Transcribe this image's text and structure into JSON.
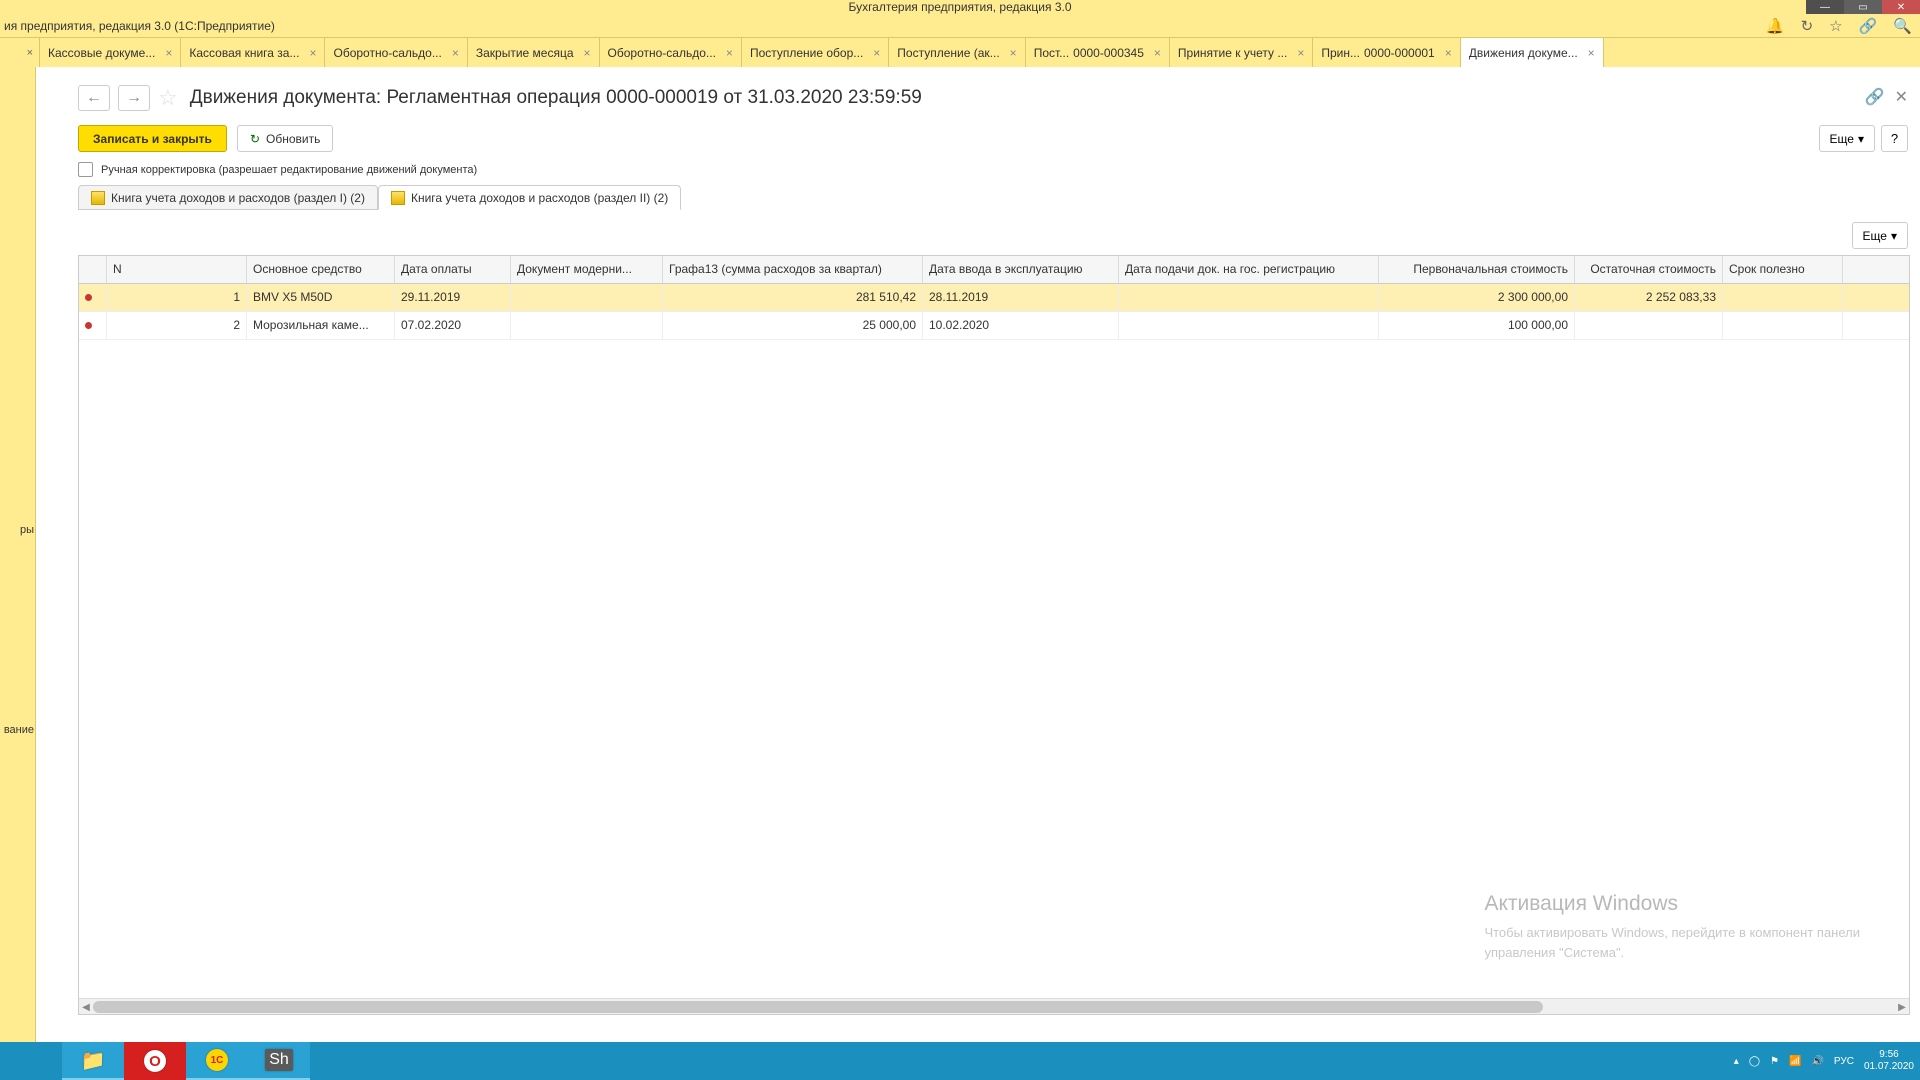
{
  "app": {
    "title": "Бухгалтерия предприятия, редакция 3.0",
    "subtitle": "ия предприятия, редакция 3.0   (1С:Предприятие)"
  },
  "tabs": {
    "items": [
      {
        "label": "Кассовые докуме..."
      },
      {
        "label": "Кассовая книга за..."
      },
      {
        "label": "Оборотно-сальдо..."
      },
      {
        "label": "Закрытие месяца"
      },
      {
        "label": "Оборотно-сальдо..."
      },
      {
        "label": "Поступление обор..."
      },
      {
        "label": "Поступление (ак..."
      },
      {
        "label": "Пост...",
        "label2": "0000-000345"
      },
      {
        "label": "Принятие к учету ..."
      },
      {
        "label": "Прин...",
        "label2": "0000-000001"
      },
      {
        "label": "Движения докуме...",
        "active": true
      }
    ]
  },
  "gutter": {
    "t1": "ры",
    "t2": "вание"
  },
  "page": {
    "title": "Движения документа: Регламентная операция 0000-000019 от 31.03.2020 23:59:59",
    "save": "Записать и закрыть",
    "refresh": "Обновить",
    "manual": "Ручная корректировка (разрешает редактирование движений документа)",
    "more": "Еще",
    "help": "?",
    "link_icon": "🔗",
    "close_icon": "✕"
  },
  "subtabs": {
    "t1": "Книга учета доходов и расходов (раздел I) (2)",
    "t2": "Книга учета доходов и расходов (раздел II) (2)"
  },
  "grid": {
    "headers": [
      "N",
      "Основное средство",
      "Дата оплаты",
      "Документ модерни...",
      "Графа13  (сумма расходов за квартал)",
      "Дата ввода в эксплуатацию",
      "Дата подачи док. на гос. регистрацию",
      "Первоначальная стоимость",
      "Остаточная стоимость",
      "Срок полезно"
    ],
    "rows": [
      {
        "n": "1",
        "asset": "BMV X5 M50D",
        "paydate": "29.11.2019",
        "moddoc": "",
        "g13": "281 510,42",
        "expdate": "28.11.2019",
        "regdate": "",
        "initcost": "2 300 000,00",
        "restcost": "2 252 083,33",
        "sel": true
      },
      {
        "n": "2",
        "asset": "Морозильная каме...",
        "paydate": "07.02.2020",
        "moddoc": "",
        "g13": "25 000,00",
        "expdate": "10.02.2020",
        "regdate": "",
        "initcost": "100 000,00",
        "restcost": "",
        "sel": false
      }
    ]
  },
  "watermark": {
    "h": "Активация Windows",
    "l1": "Чтобы активировать Windows, перейдите в компонент панели",
    "l2": "управления \"Система\"."
  },
  "tray": {
    "lang": "РУС",
    "time": "9:56",
    "date": "01.07.2020"
  }
}
